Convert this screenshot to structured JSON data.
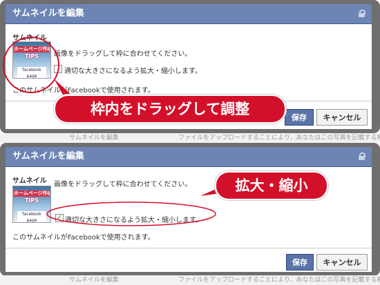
{
  "peek_strips": [
    {
      "left": "サムネイルを編集",
      "right": "ファイルをアップロードすることにより、あなたはこの写真を記載する権利"
    },
    {
      "left": "サムネイルを編集",
      "right": "ファイルをアップロードすることにより、あなたはこの写真を記載する権利"
    }
  ],
  "panels": [
    {
      "title": "サムネイルを編集",
      "section_label": "サムネイル",
      "thumbnail": {
        "line1": "ホームページ作成",
        "line2": "TIPS",
        "line3": "facebook page"
      },
      "instruction": "画像をドラッグして枠に合わせてください。",
      "checkbox_label": "適切な大きさになるよう拡大・縮小します。",
      "checkbox_checked": false,
      "footnote": "このサムネイルがFacebookで使用されます。",
      "save_label": "保存",
      "cancel_label": "キャンセル",
      "callout": "枠内をドラッグして調整"
    },
    {
      "title": "サムネイルを編集",
      "section_label": "サムネイル",
      "thumbnail": {
        "line1": "ホームページ作成",
        "line2": "TIPS",
        "line3": "facebook page"
      },
      "instruction": "画像をドラッグして枠に合わせてください。",
      "checkbox_label": "適切な大きさになるよう拡大・縮小します。",
      "checkbox_checked": true,
      "checkbox_mark": "✓",
      "footnote": "このサムネイルがFacebookで使用されます。",
      "save_label": "保存",
      "cancel_label": "キャンセル",
      "callout": "拡大・縮小"
    }
  ],
  "colors": {
    "titlebar": "#6d84b4",
    "callout": "#d3102a",
    "save_button": "#5b74a8"
  }
}
